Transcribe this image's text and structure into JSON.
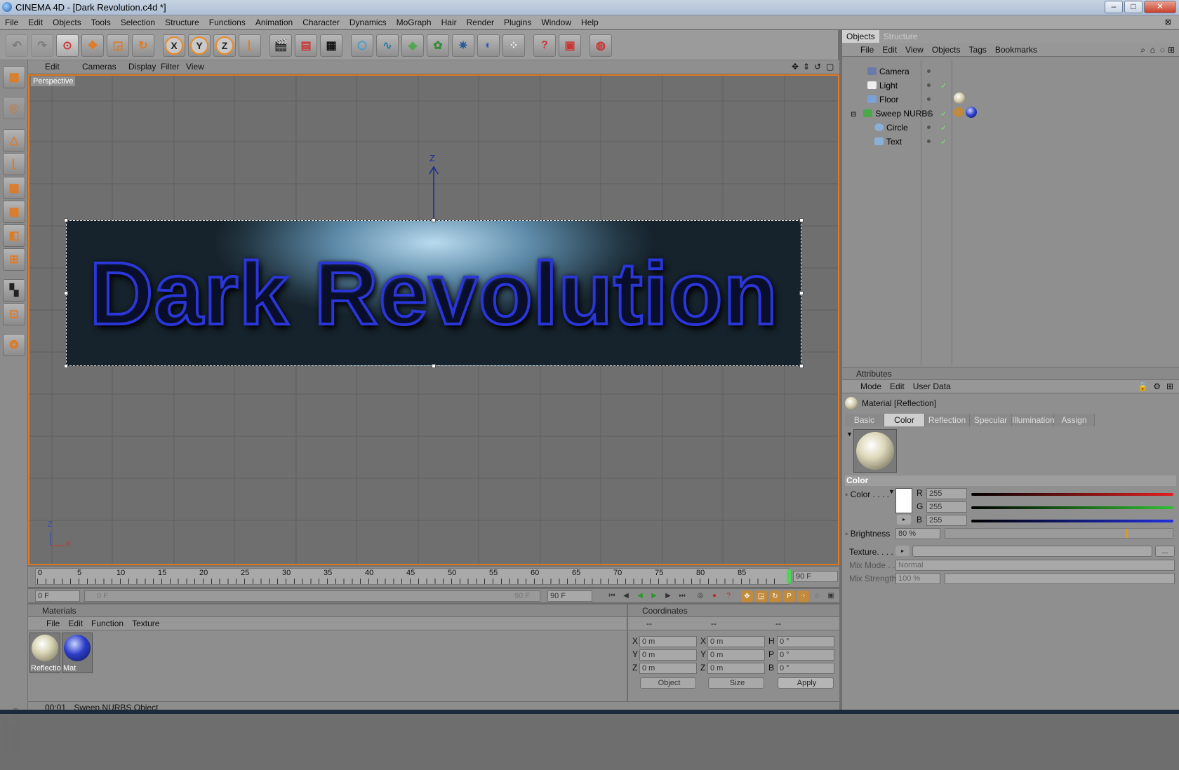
{
  "window": {
    "title": "CINEMA 4D - [Dark Revolution.c4d *]",
    "minimize_icon": "minimize-icon",
    "maximize_icon": "maximize-icon",
    "close_icon": "close-icon"
  },
  "menubar": [
    "File",
    "Edit",
    "Objects",
    "Tools",
    "Selection",
    "Structure",
    "Functions",
    "Animation",
    "Character",
    "Dynamics",
    "MoGraph",
    "Hair",
    "Render",
    "Plugins",
    "Window",
    "Help"
  ],
  "viewport": {
    "menu": [
      "Edit",
      "Cameras",
      "Display",
      "Filter",
      "View"
    ],
    "label": "Perspective",
    "scene_text": "Dark Revolution",
    "axis_label": "Z",
    "corner_axis_z": "Z",
    "corner_axis_x": "X"
  },
  "timeline": {
    "ticks": [
      "0",
      "5",
      "10",
      "15",
      "20",
      "25",
      "30",
      "35",
      "40",
      "45",
      "50",
      "55",
      "60",
      "65",
      "70",
      "75",
      "80",
      "85"
    ],
    "end_frame": "90 F",
    "current_frame": "0 F",
    "range_start": "0 F",
    "range_end": "90 F",
    "max_frame": "90 F"
  },
  "materials": {
    "title": "Materials",
    "menu": [
      "File",
      "Edit",
      "Function",
      "Texture"
    ],
    "items": [
      {
        "name": "Reflectio",
        "color": "#e9e6d6"
      },
      {
        "name": "Mat",
        "color": "#2c3ec9"
      }
    ]
  },
  "coordinates": {
    "title": "Coordinates",
    "col_headers": [
      "--",
      "--",
      "--"
    ],
    "rows": [
      {
        "a": "X",
        "av": "0 m",
        "b": "X",
        "bv": "0 m",
        "c": "H",
        "cv": "0 °"
      },
      {
        "a": "Y",
        "av": "0 m",
        "b": "Y",
        "bv": "0 m",
        "c": "P",
        "cv": "0 °"
      },
      {
        "a": "Z",
        "av": "0 m",
        "b": "Z",
        "bv": "0 m",
        "c": "B",
        "cv": "0 °"
      }
    ],
    "mode_select": "Object",
    "size_select": "Size",
    "apply": "Apply"
  },
  "status": {
    "time": "00:01",
    "message": "Sweep NURBS Object"
  },
  "objects_panel": {
    "tabs": [
      "Objects",
      "Structure"
    ],
    "menu": [
      "File",
      "Edit",
      "View",
      "Objects",
      "Tags",
      "Bookmarks"
    ],
    "items": [
      {
        "name": "Camera",
        "indent": 0,
        "icon": "camera-icon"
      },
      {
        "name": "Light",
        "indent": 0,
        "icon": "light-icon"
      },
      {
        "name": "Floor",
        "indent": 0,
        "icon": "floor-icon"
      },
      {
        "name": "Sweep NURBS",
        "indent": 0,
        "icon": "sweep-nurbs-icon"
      },
      {
        "name": "Circle",
        "indent": 1,
        "icon": "circle-spline-icon"
      },
      {
        "name": "Text",
        "indent": 1,
        "icon": "text-spline-icon"
      }
    ]
  },
  "attributes": {
    "title": "Attributes",
    "menu": [
      "Mode",
      "Edit",
      "User Data"
    ],
    "material_title": "Material [Reflection]",
    "tabs": [
      "Basic",
      "Color",
      "Reflection",
      "Specular",
      "Illumination",
      "Assign"
    ],
    "active_tab": "Color",
    "section": "Color",
    "color_label": "Color . . . .",
    "r_label": "R",
    "r_value": "255",
    "g_label": "G",
    "g_value": "255",
    "b_label": "B",
    "b_value": "255",
    "brightness_label": "Brightness",
    "brightness_value": "80 %",
    "brightness_fraction": 0.8,
    "texture_label": "Texture. . . .",
    "texture_button": "...",
    "mix_mode_label": "Mix Mode . .",
    "mix_mode_value": "Normal",
    "mix_strength_label": "Mix Strength",
    "mix_strength_value": "100 %"
  },
  "colors": {
    "accent_orange": "#e07a22",
    "text_blue": "#2a36d8",
    "red_slider": "#e02020",
    "green_slider": "#30c030",
    "blue_slider": "#2030e0"
  }
}
